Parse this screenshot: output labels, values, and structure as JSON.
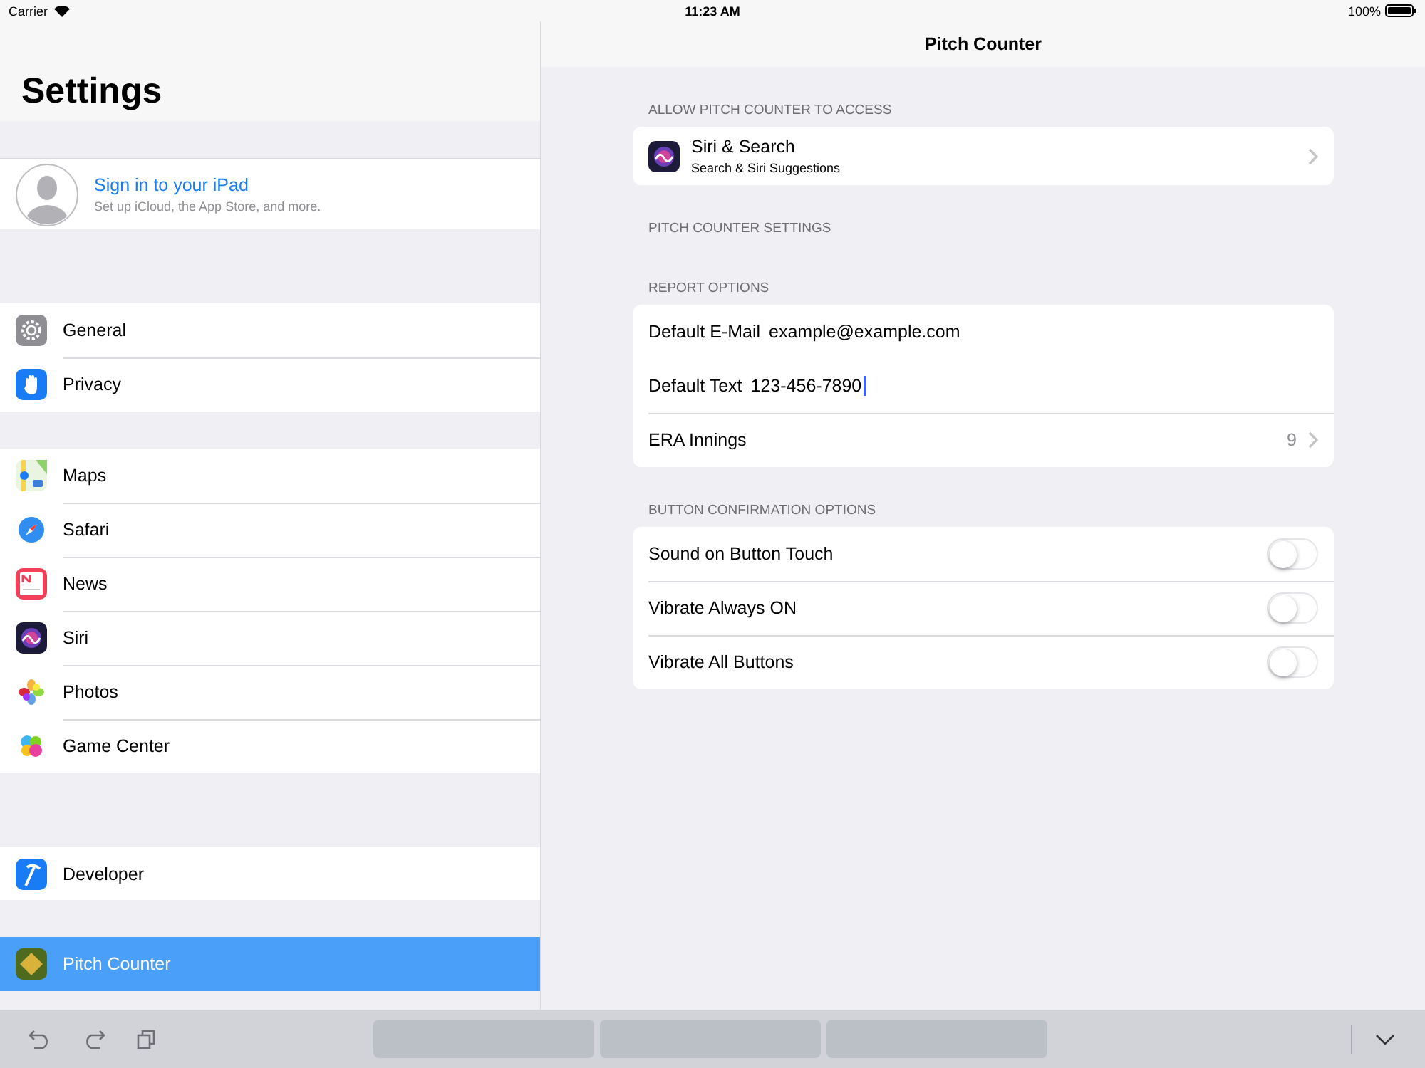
{
  "status_bar": {
    "carrier": "Carrier",
    "time": "11:23 AM",
    "battery": "100%"
  },
  "sidebar": {
    "title": "Settings",
    "account": {
      "title": "Sign in to your iPad",
      "subtitle": "Set up iCloud, the App Store, and more."
    },
    "groups": [
      {
        "items": [
          {
            "label": "General",
            "selected": false
          },
          {
            "label": "Privacy",
            "selected": false
          }
        ]
      },
      {
        "items": [
          {
            "label": "Maps",
            "selected": false
          },
          {
            "label": "Safari",
            "selected": false
          },
          {
            "label": "News",
            "selected": false
          },
          {
            "label": "Siri",
            "selected": false
          },
          {
            "label": "Photos",
            "selected": false
          },
          {
            "label": "Game Center",
            "selected": false
          }
        ]
      },
      {
        "items": [
          {
            "label": "Developer",
            "selected": false
          }
        ]
      },
      {
        "items": [
          {
            "label": "Pitch Counter",
            "selected": true
          }
        ]
      }
    ]
  },
  "detail": {
    "title": "Pitch Counter",
    "sections": [
      {
        "header": "ALLOW PITCH COUNTER TO ACCESS",
        "rows": [
          {
            "kind": "link",
            "label": "Siri & Search",
            "subtitle": "Search & Siri Suggestions"
          }
        ]
      },
      {
        "header": "PITCH COUNTER SETTINGS"
      },
      {
        "header": "REPORT OPTIONS",
        "rows": [
          {
            "kind": "field",
            "label": "Default E-Mail",
            "value": "example@example.com",
            "focused": false
          },
          {
            "kind": "field",
            "label": "Default Text",
            "value": "123-456-7890",
            "focused": true
          },
          {
            "kind": "value",
            "label": "ERA Innings",
            "value": "9"
          }
        ]
      },
      {
        "header": "BUTTON CONFIRMATION OPTIONS",
        "rows": [
          {
            "kind": "toggle",
            "label": "Sound on Button Touch",
            "on": false
          },
          {
            "kind": "toggle",
            "label": "Vibrate Always ON",
            "on": false
          },
          {
            "kind": "toggle",
            "label": "Vibrate All Buttons",
            "on": false
          }
        ]
      }
    ]
  }
}
